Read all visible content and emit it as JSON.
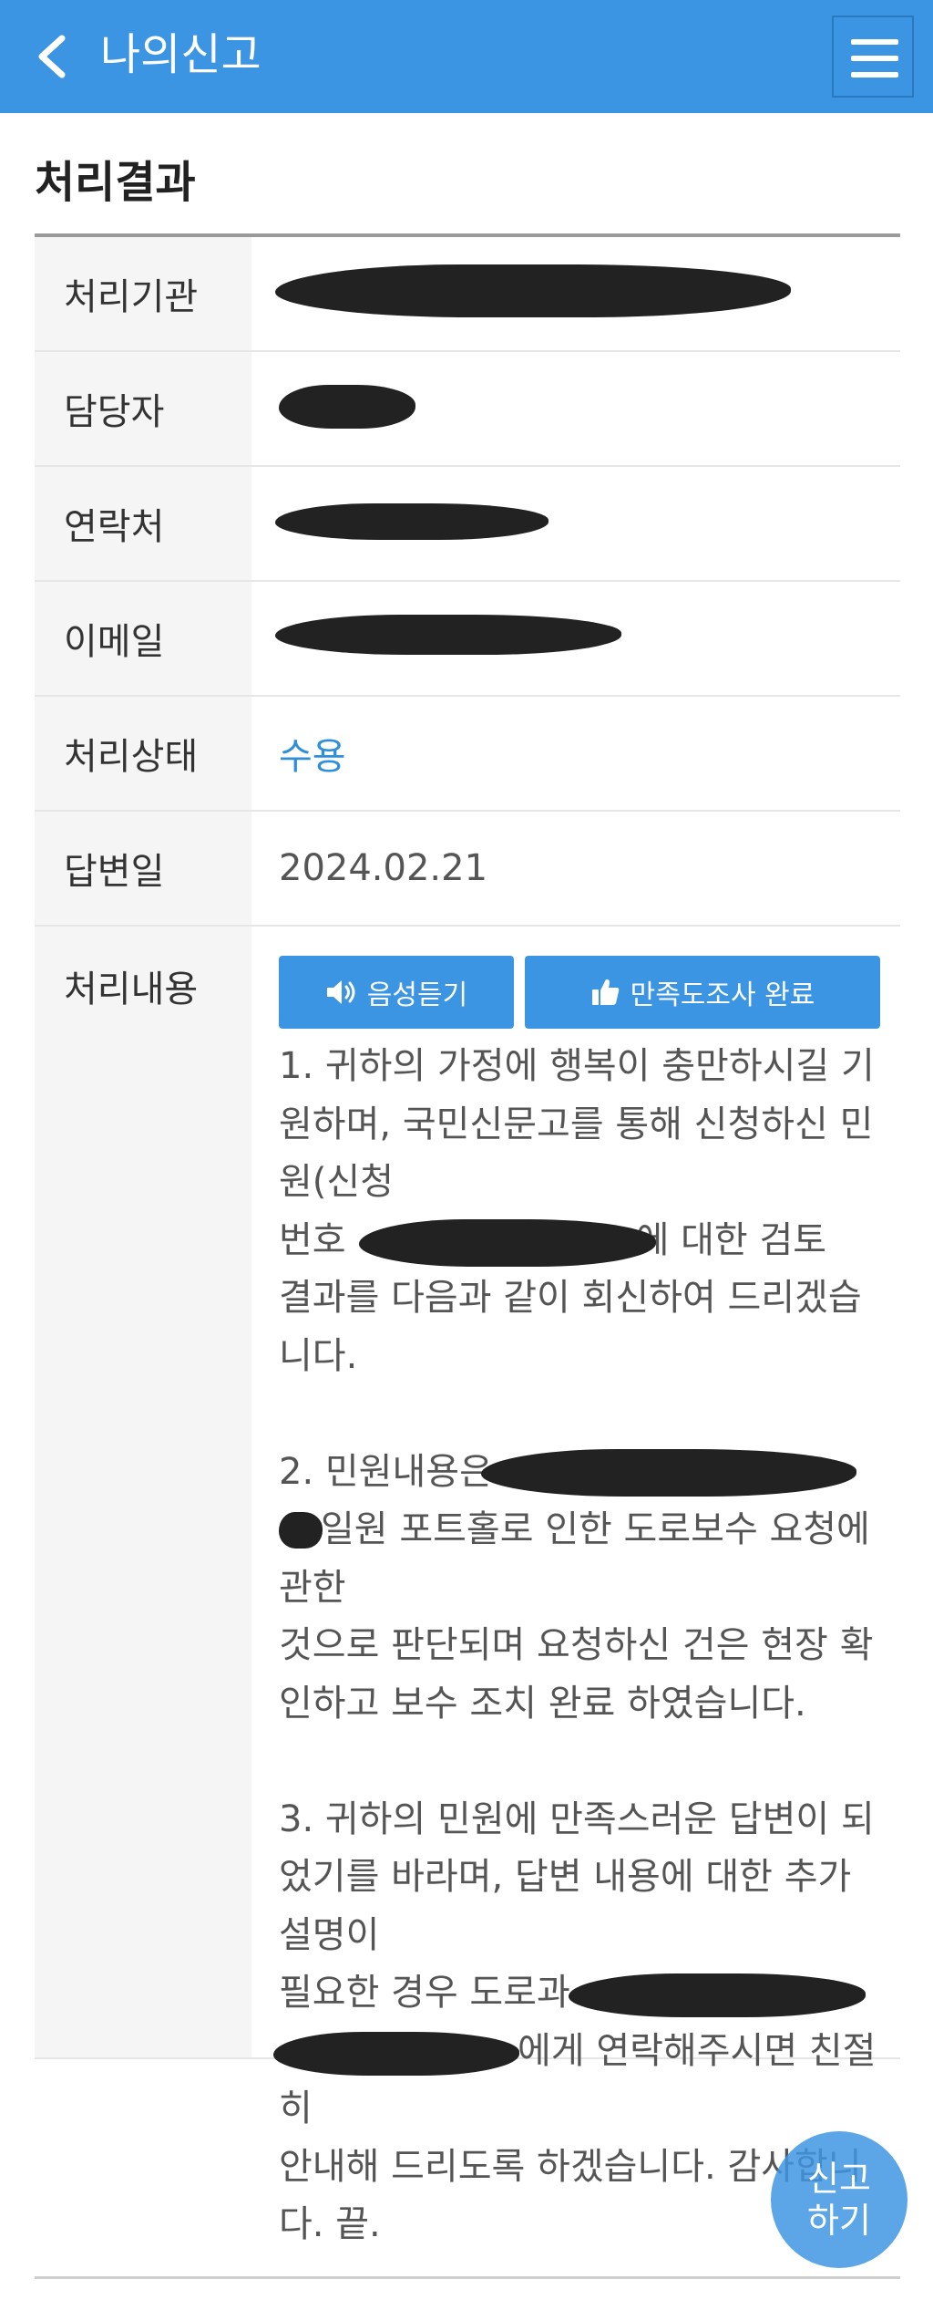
{
  "header": {
    "title": "나의신고",
    "back_icon": "chevron-left-icon",
    "menu_icon": "hamburger-menu-icon"
  },
  "section": {
    "title": "처리결과"
  },
  "fields": {
    "agency_label": "처리기관",
    "manager_label": "담당자",
    "contact_label": "연락처",
    "email_label": "이메일",
    "status_label": "처리상태",
    "status_value": "수용",
    "answer_date_label": "답변일",
    "answer_date_value": "2024.02.21",
    "content_label": "처리내용"
  },
  "buttons": {
    "voice_label": "음성듣기",
    "survey_label": "만족도조사 완료"
  },
  "answer": {
    "l1": "1. 귀하의 가정에 행복이 충만하시길 기",
    "l2": "원하며, 국민신문고를 통해 신청하신 민",
    "l3": "원(신청",
    "l4a": "번호",
    "l4b": "에 대한 검토",
    "l5": "결과를 다음과 같이 회신하여 드리겠습",
    "l6": "니다.",
    "l7": "2. 민원내용은",
    "l8": "일원 포트홀로 인한 도로보수 요청에",
    "l9": "관한",
    "l10": "것으로 판단되며 요청하신 건은 현장 확",
    "l11": "인하고 보수 조치 완료 하였습니다.",
    "l12": "3. 귀하의 민원에 만족스러운 답변이 되",
    "l13": "었기를 바라며, 답변 내용에 대한 추가",
    "l14": "설명이",
    "l15": "필요한 경우 도로과",
    "l16": "에게 연락해주시면 친절",
    "l17": "히",
    "l18": "안내해 드리도록 하겠습니다. 감사합니",
    "l19": "다. 끝."
  },
  "fab": {
    "line1": "신고",
    "line2": "하기"
  },
  "colors": {
    "header_bg": "#3b95e2",
    "status_accepted": "#2f8fd9",
    "button_bg": "#3b95e2"
  }
}
